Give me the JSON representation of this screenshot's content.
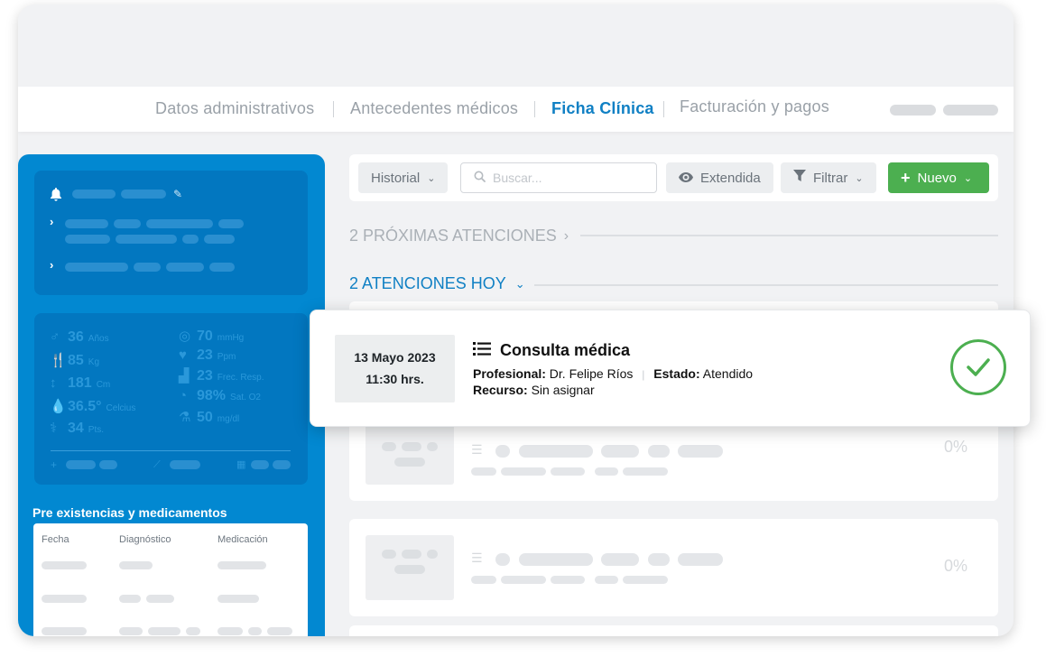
{
  "tabs": [
    {
      "label": "Datos administrativos",
      "active": false
    },
    {
      "label": "Antecedentes médicos",
      "active": false
    },
    {
      "label": "Ficha Clínica",
      "active": true
    },
    {
      "label": "Facturación y pagos",
      "active": false
    }
  ],
  "vitals": [
    {
      "icon": "male-icon",
      "value": "36",
      "unit": "Años"
    },
    {
      "icon": "utensils-icon",
      "value": "85",
      "unit": "Kg"
    },
    {
      "icon": "height-arrows-icon",
      "value": "181",
      "unit": "Cm"
    },
    {
      "icon": "drop-icon",
      "value": "36.5°",
      "unit": "Celcius"
    },
    {
      "icon": "stethoscope-icon",
      "value": "34",
      "unit": "Pts."
    },
    {
      "icon": "gauge-icon",
      "value": "70",
      "unit": "mmHg"
    },
    {
      "icon": "heart-pulse-icon",
      "value": "23",
      "unit": "Ppm"
    },
    {
      "icon": "area-chart-icon",
      "value": "23",
      "unit": "Frec. Resp."
    },
    {
      "icon": "compass-icon",
      "value": "98%",
      "unit": "Sat. O2"
    },
    {
      "icon": "flask-icon",
      "value": "50",
      "unit": "mg/dl"
    }
  ],
  "sidebar": {
    "section_title": "Pre existencias y medicamentos",
    "table_headers": [
      "Fecha",
      "Diagnóstico",
      "Medicación"
    ]
  },
  "toolbar": {
    "history_label": "Historial",
    "search_placeholder": "Buscar...",
    "extended_label": "Extendida",
    "filter_label": "Filtrar",
    "new_label": "Nuevo"
  },
  "sections": {
    "upcoming": "2 PRÓXIMAS ATENCIONES",
    "today": "2 ATENCIONES HOY"
  },
  "appointment": {
    "date": "13 Mayo 2023",
    "time": "11:30 hrs.",
    "title": "Consulta médica",
    "professional_label": "Profesional:",
    "professional": "Dr. Felipe Ríos",
    "status_label": "Estado:",
    "status": "Atendido",
    "resource_label": "Recurso:",
    "resource": "Sin asignar"
  },
  "placeholder_cards": [
    {
      "percent": "0%"
    },
    {
      "percent": "0%"
    }
  ],
  "colors": {
    "primary": "#0288d1",
    "active_tab": "#1080c4",
    "success": "#4caf50"
  }
}
